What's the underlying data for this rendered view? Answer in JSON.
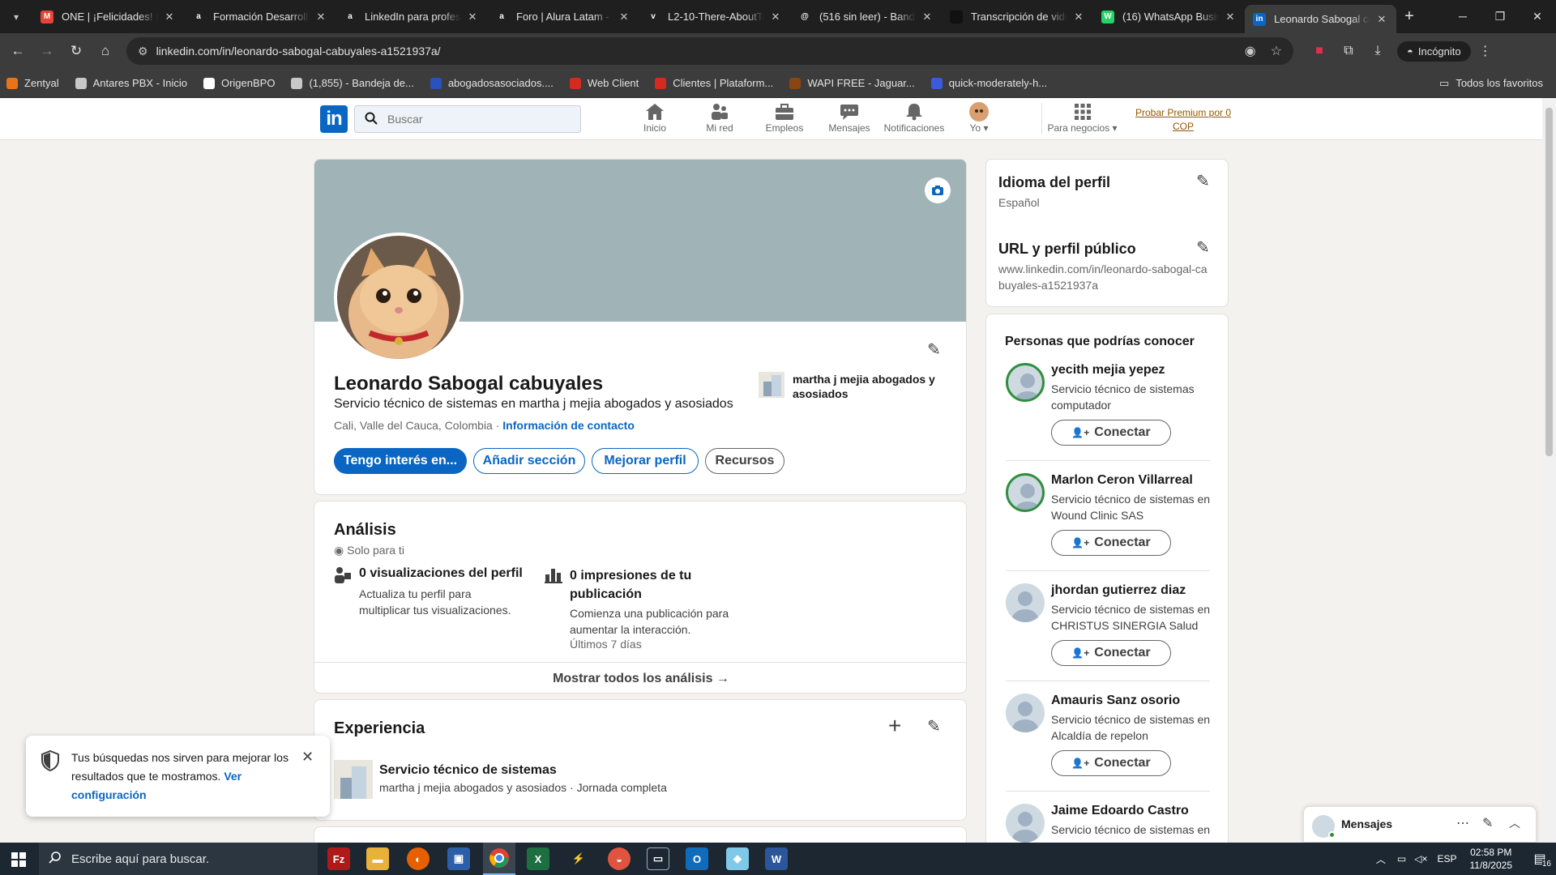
{
  "browser": {
    "tabs": [
      {
        "title": "ONE | ¡Felicidades! Fu",
        "icon": "gmail-icon",
        "color": "#ea4335",
        "letter": "M"
      },
      {
        "title": "Formación Desarrollo",
        "icon": "alura-icon",
        "color": "#1f1f1f",
        "letter": "a"
      },
      {
        "title": "LinkedIn para profesi",
        "icon": "alura-icon",
        "color": "#1f1f1f",
        "letter": "a"
      },
      {
        "title": "Foro | Alura Latam - C",
        "icon": "alura-icon",
        "color": "#1f1f1f",
        "letter": "a"
      },
      {
        "title": "L2-10-There-AboutTo",
        "icon": "vimeo-icon",
        "color": "#1f1f1f",
        "letter": "v"
      },
      {
        "title": "(516 sin leer) - Bande",
        "icon": "mail-icon",
        "color": "#1f1f1f",
        "letter": "@"
      },
      {
        "title": "Transcripción de vide",
        "icon": "dark-icon",
        "color": "#111111",
        "letter": ""
      },
      {
        "title": "(16) WhatsApp Busin",
        "icon": "whatsapp-icon",
        "color": "#25d366",
        "letter": "W"
      },
      {
        "title": "Leonardo Sabogal ca",
        "icon": "linkedin-icon",
        "color": "#0a66c2",
        "letter": "in"
      }
    ],
    "url": "linkedin.com/in/leonardo-sabogal-cabuyales-a1521937a/",
    "incognito_label": "Incógnito",
    "bookmarks": [
      {
        "label": "Zentyal",
        "color": "#e8741a"
      },
      {
        "label": "Antares PBX - Inicio",
        "color": "#c8c8c8"
      },
      {
        "label": "OrigenBPO",
        "color": "#ffffff"
      },
      {
        "label": "(1,855) - Bandeja de...",
        "color": "#c8c8c8"
      },
      {
        "label": "abogadosasociados....",
        "color": "#2a52be"
      },
      {
        "label": "Web Client",
        "color": "#d52b1e"
      },
      {
        "label": "Clientes | Plataform...",
        "color": "#d52b1e"
      },
      {
        "label": "WAPI FREE - Jaguar...",
        "color": "#8b4513"
      },
      {
        "label": "quick-moderately-h...",
        "color": "#3b5bdb"
      }
    ],
    "bookmarks_folder": "Todos los favoritos"
  },
  "linkedin": {
    "search_placeholder": "Buscar",
    "nav": [
      {
        "label": "Inicio",
        "icon": "home-icon"
      },
      {
        "label": "Mi red",
        "icon": "network-icon"
      },
      {
        "label": "Empleos",
        "icon": "briefcase-icon"
      },
      {
        "label": "Mensajes",
        "icon": "messaging-icon"
      },
      {
        "label": "Notificaciones",
        "icon": "bell-icon"
      },
      {
        "label": "Yo",
        "icon": "avatar-icon"
      },
      {
        "label": "Para negocios",
        "icon": "grid-icon"
      }
    ],
    "premium": "Probar Premium por 0 COP",
    "profile": {
      "name": "Leonardo Sabogal cabuyales",
      "headline": "Servicio técnico de sistemas en martha j mejia abogados y asosiados",
      "location": "Cali, Valle del Cauca, Colombia",
      "contact_link": "Información de contacto",
      "company": "martha j mejia abogados y asosiados",
      "buttons": {
        "primary": "Tengo interés en...",
        "add_section": "Añadir sección",
        "improve": "Mejorar perfil",
        "resources": "Recursos"
      }
    },
    "analytics": {
      "title": "Análisis",
      "private": "Solo para ti",
      "views_title": "0 visualizaciones del perfil",
      "views_desc": "Actualiza tu perfil para multiplicar tus visualizaciones.",
      "impr_title": "0 impresiones de tu publicación",
      "impr_desc": "Comienza una publicación para aumentar la interacción.",
      "impr_period": "Últimos 7 días",
      "show_all": "Mostrar todos los análisis →"
    },
    "experience": {
      "title": "Experiencia",
      "role": "Servicio técnico de sistemas",
      "company": "martha j mejia abogados y asosiados · Jornada completa"
    },
    "sidebar": {
      "lang_title": "Idioma del perfil",
      "lang_value": "Español",
      "url_title": "URL y perfil público",
      "url_value": "www.linkedin.com/in/leonardo-sabogal-cabuyales-a1521937a"
    },
    "pymk": {
      "title": "Personas que podrías conocer",
      "connect_label": "Conectar",
      "people": [
        {
          "name": "yecith mejia yepez",
          "headline": "Servicio técnico de sistemas computador",
          "ring": true
        },
        {
          "name": "Marlon Ceron Villarreal",
          "headline": "Servicio técnico de sistemas en Wound Clinic SAS",
          "ring": true
        },
        {
          "name": "jhordan gutierrez diaz",
          "headline": "Servicio técnico de sistemas en CHRISTUS SINERGIA Salud",
          "ring": false
        },
        {
          "name": "Amauris Sanz osorio",
          "headline": "Servicio técnico de sistemas en Alcaldía de repelon",
          "ring": false
        },
        {
          "name": "Jaime Edoardo Castro",
          "headline": "Servicio técnico de sistemas en",
          "ring": false
        }
      ]
    },
    "messaging": {
      "label": "Mensajes"
    },
    "toast": {
      "text": "Tus búsquedas nos sirven para mejorar los resultados que te mostramos.",
      "link": "Ver configuración"
    }
  },
  "taskbar": {
    "search_placeholder": "Escribe aquí para buscar.",
    "lang": "ESP",
    "time": "02:58 PM",
    "date": "11/8/2025",
    "notifications": "16"
  }
}
